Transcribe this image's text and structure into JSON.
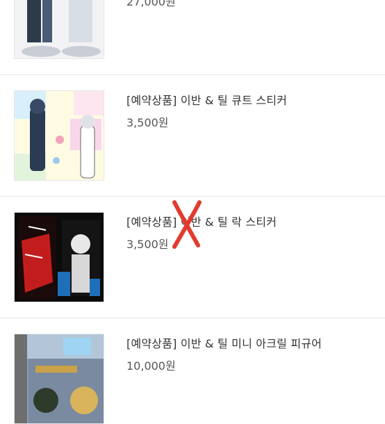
{
  "products": [
    {
      "title": "",
      "price": "27,000원",
      "thumb": "acrylic-stand-photo"
    },
    {
      "title": "[예약상품] 이반 & 틸 큐트 스티커",
      "price": "3,500원",
      "thumb": "cute-sticker-photo"
    },
    {
      "title": "[예약상품] 이반 & 틸 락 스티커",
      "price": "3,500원",
      "thumb": "rock-sticker-photo"
    },
    {
      "title": "[예약상품] 이반 & 틸 미니 아크릴 피규어",
      "price": "10,000원",
      "thumb": "mini-acrylic-figure-photo"
    }
  ],
  "annotation": {
    "mark": "X",
    "color": "#e23b2e"
  }
}
